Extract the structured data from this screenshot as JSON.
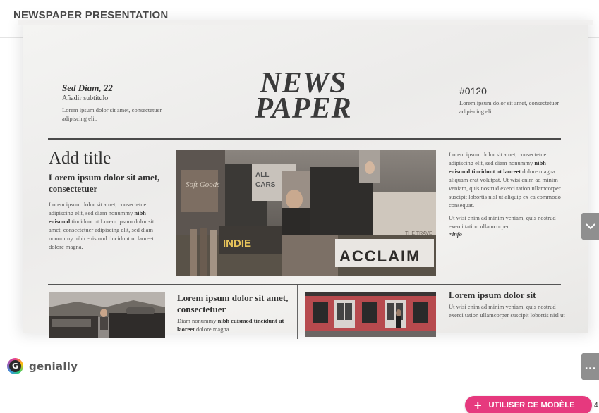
{
  "header": {
    "title": "NEWSPAPER PRESENTATION"
  },
  "newspaper": {
    "left_header": {
      "date": "Sed Diam, 22",
      "subtitle": "Añadir subtítulo",
      "text": "Lorem ipsum dolor sit amet, consectetuer adipiscing elit."
    },
    "masthead_line1": "NEWS",
    "masthead_line2": "PAPER",
    "right_header": {
      "number": "#0120",
      "text": "Lorem ipsum dolor sit amet, consectetuer adipiscing elit."
    },
    "main_article": {
      "title": "Add title",
      "lead": "Lorem ipsum dolor sit amet, consectetuer",
      "body_1": "Lorem ipsum dolor sit amet, consectetuer adipiscing elit, sed diam nonummy",
      "body_1_bold": "nibh euismod",
      "body_1_end": "tincidunt ut Lorem ipsum dolor sit amet, consectetuer adipiscing elit, sed diam nonummy nibh euismod tincidunt ut laoreet dolore magna."
    },
    "photo_main_signs": [
      "INDIE",
      "ACCLAIM",
      "Soft Goods",
      "THE TRAVE"
    ],
    "right_column": {
      "p1_start": "Lorem ipsum dolor sit amet, consectetuer adipiscing elit, sed diam nonummy",
      "p1_bold": "nibh euismod tincidunt ut laoreet",
      "p1_end": "dolore magna aliquam erat volutpat. Ut wisi enim ad minim veniam, quis nostrud exerci tation ullamcorper suscipit lobortis nisl ut aliquip ex ea commodo consequat.",
      "p2": "Ut wisi enim ad minim veniam, quis nostrud exerci tation ullamcorper",
      "more_info": "+info"
    },
    "article_2": {
      "title": "Lorem ipsum dolor sit amet, consectetuer",
      "text_start": "Diam nonummy",
      "text_bold": "nibh euismod tincidunt ut laoreet",
      "text_end": "dolore magna."
    },
    "article_3": {
      "title": "Lorem ipsum dolor sit",
      "text": "Ut wisi enim ad minim veniam, quis nostrud exerci tation ullamcorper suscipit lobortis nisl ut"
    }
  },
  "branding": {
    "logo_letter": "G",
    "logo_text": "genially"
  },
  "controls": {
    "nav_down_icon": "chevron-down-icon",
    "more_icon": "more-dots-icon",
    "more_label": "...",
    "cta_icon": "plus-icon",
    "cta_plus": "+",
    "cta_label": "UTILISER CE MODÈLE",
    "edge_fragment": "4"
  },
  "colors": {
    "accent": "#e6397e",
    "nav_button": "#8f8f8f",
    "ink": "#333333"
  }
}
